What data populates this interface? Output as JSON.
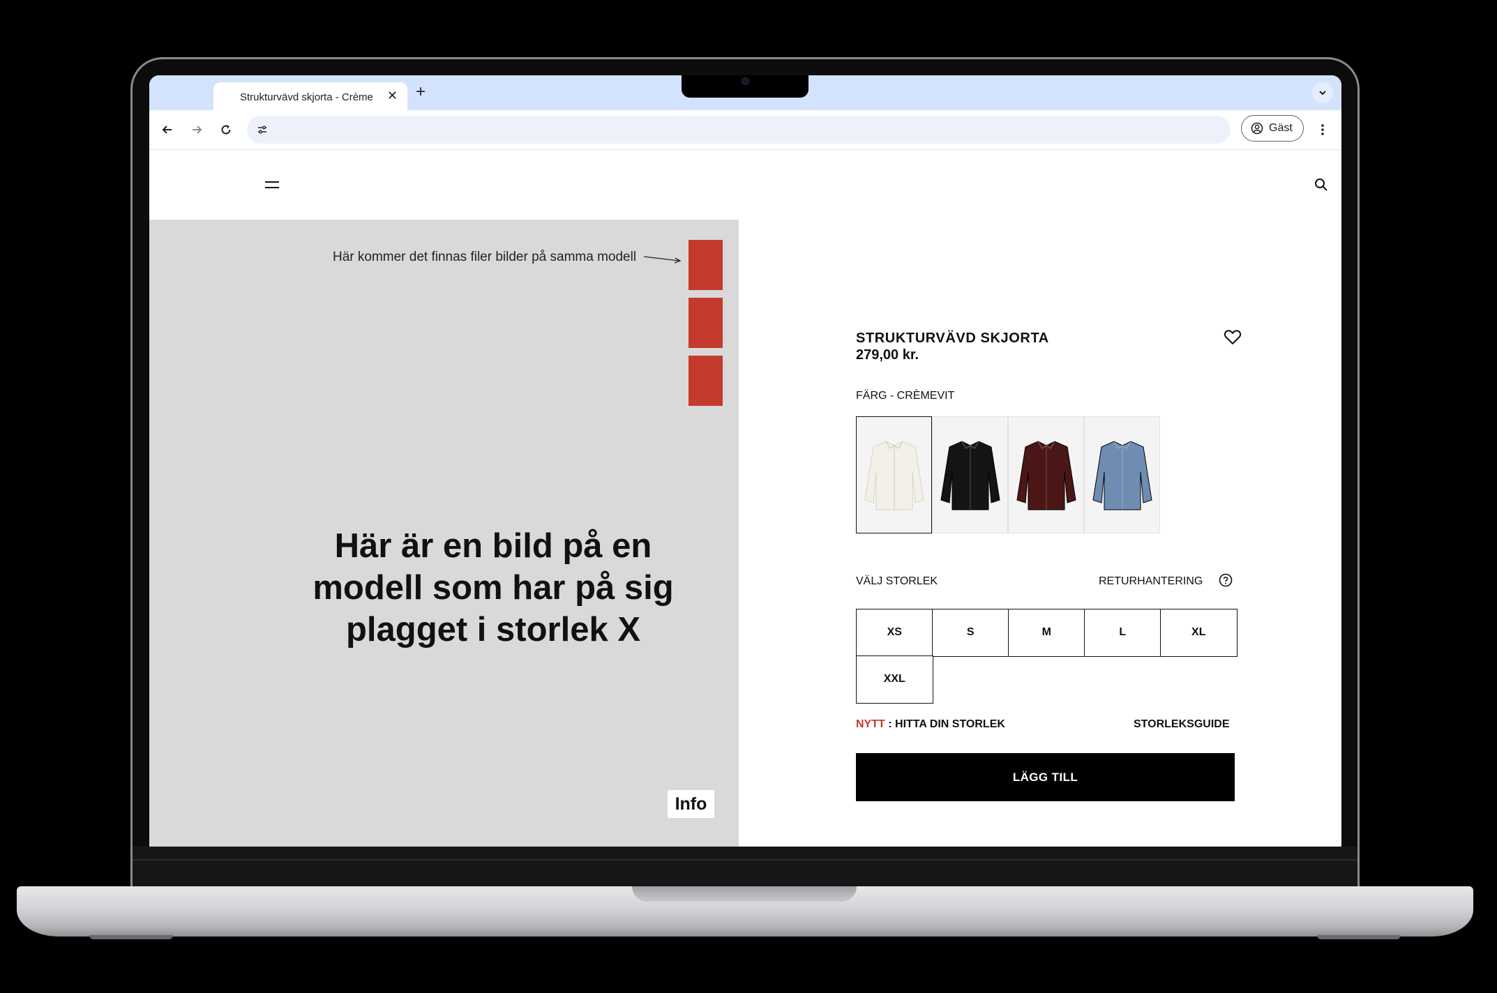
{
  "browser": {
    "tab_title": "Strukturvävd skjorta - Crème",
    "tab_close": "✕",
    "new_tab": "+",
    "profile_label": "Gäst"
  },
  "gallery": {
    "annotation": "Här kommer det finnas filer bilder på samma modell",
    "model_placeholder": "Här är en bild på en modell som har på sig plagget i storlek X",
    "info_button": "Info",
    "thumbnail_color": "#c43a2c",
    "background_color": "#d9d9d9"
  },
  "product": {
    "title": "STRUKTURVÄVD SKJORTA",
    "price": "279,00 kr.",
    "color_label": "FÄRG - CRÈMEVIT",
    "swatches": [
      {
        "name": "crèmevit",
        "color": "#f3f0e8"
      },
      {
        "name": "svart",
        "color": "#141414"
      },
      {
        "name": "vinröd",
        "color": "#4a1616"
      },
      {
        "name": "blå",
        "color": "#6f8db3"
      }
    ],
    "size_label": "VÄLJ STORLEK",
    "returns_label": "RETURHANTERING",
    "sizes": [
      "XS",
      "S",
      "M",
      "L",
      "XL",
      "XXL"
    ],
    "find_size_new": "NYTT",
    "find_size_text": ": HITTA DIN STORLEK",
    "size_guide": "STORLEKSGUIDE",
    "add_to_cart": "LÄGG TILL",
    "accent_color": "#c43a2c"
  }
}
